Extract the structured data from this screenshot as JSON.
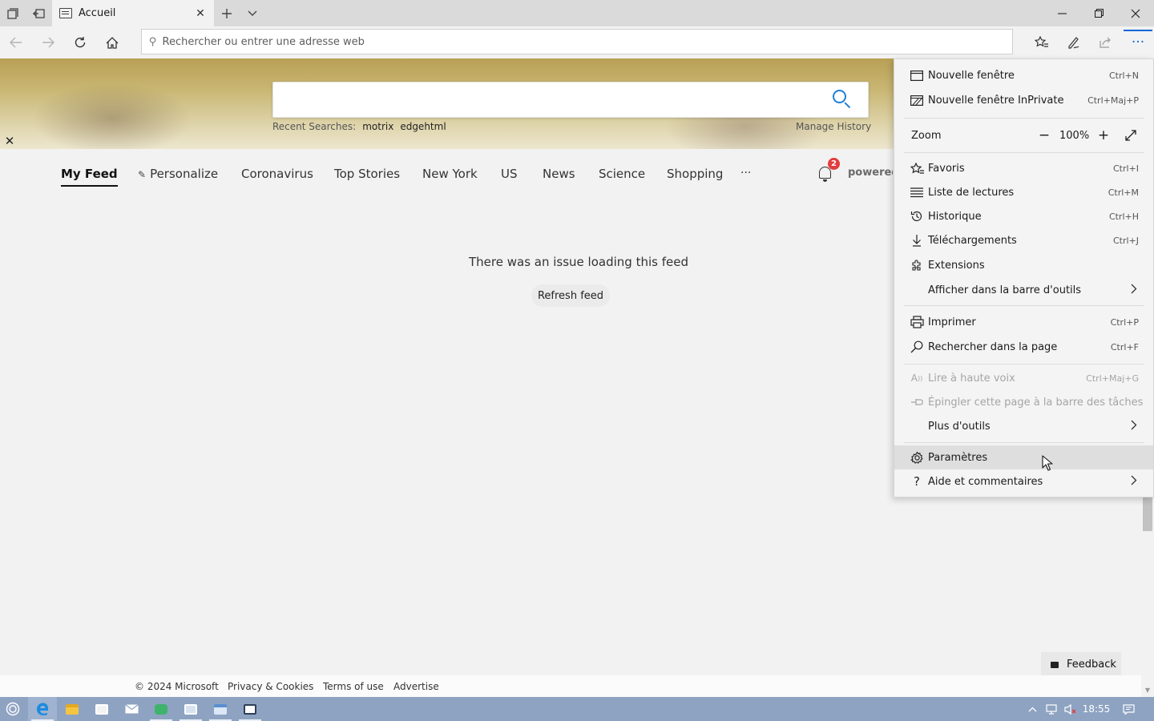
{
  "browser": {
    "tab_title": "Accueil",
    "tab_icon": "newtab-page-icon",
    "address_placeholder": "Rechercher ou entrer une adresse web"
  },
  "hero": {
    "recent_label": "Recent Searches:",
    "recent_terms": [
      "motrix",
      "edgehtml"
    ],
    "manage_history": "Manage History"
  },
  "feed_nav": {
    "items": [
      "My Feed",
      "Personalize",
      "Coronavirus",
      "Top Stories",
      "New York",
      "US",
      "News",
      "Science",
      "Shopping"
    ],
    "more": "···",
    "notification_count": "2",
    "powered_by": "powered"
  },
  "feed": {
    "error_message": "There was an issue loading this feed",
    "refresh_label": "Refresh feed"
  },
  "footer": {
    "copyright": "© 2024 Microsoft",
    "links": [
      "Privacy & Cookies",
      "Terms of use",
      "Advertise"
    ],
    "feedback": "Feedback"
  },
  "menu": {
    "items": [
      {
        "label": "Nouvelle fenêtre",
        "shortcut": "Ctrl+N"
      },
      {
        "label": "Nouvelle fenêtre InPrivate",
        "shortcut": "Ctrl+Maj+P"
      },
      {
        "label": "Favoris",
        "shortcut": "Ctrl+I"
      },
      {
        "label": "Liste de lectures",
        "shortcut": "Ctrl+M"
      },
      {
        "label": "Historique",
        "shortcut": "Ctrl+H"
      },
      {
        "label": "Téléchargements",
        "shortcut": "Ctrl+J"
      },
      {
        "label": "Extensions",
        "shortcut": ""
      },
      {
        "label": "Afficher dans la barre d'outils",
        "shortcut": ""
      },
      {
        "label": "Imprimer",
        "shortcut": "Ctrl+P"
      },
      {
        "label": "Rechercher dans la page",
        "shortcut": "Ctrl+F"
      },
      {
        "label": "Lire à haute voix",
        "shortcut": "Ctrl+Maj+G"
      },
      {
        "label": "Épingler cette page à la barre des tâches",
        "shortcut": ""
      },
      {
        "label": "Plus d'outils",
        "shortcut": ""
      },
      {
        "label": "Paramètres",
        "shortcut": ""
      },
      {
        "label": "Aide et commentaires",
        "shortcut": ""
      }
    ],
    "zoom_label": "Zoom",
    "zoom_value": "100%"
  },
  "taskbar": {
    "clock": "18:55"
  },
  "colors": {
    "accent": "#0a66d6",
    "badge": "#e33d3d",
    "taskbar": "#8ea3c2",
    "search_icon": "#1e7fd9"
  }
}
